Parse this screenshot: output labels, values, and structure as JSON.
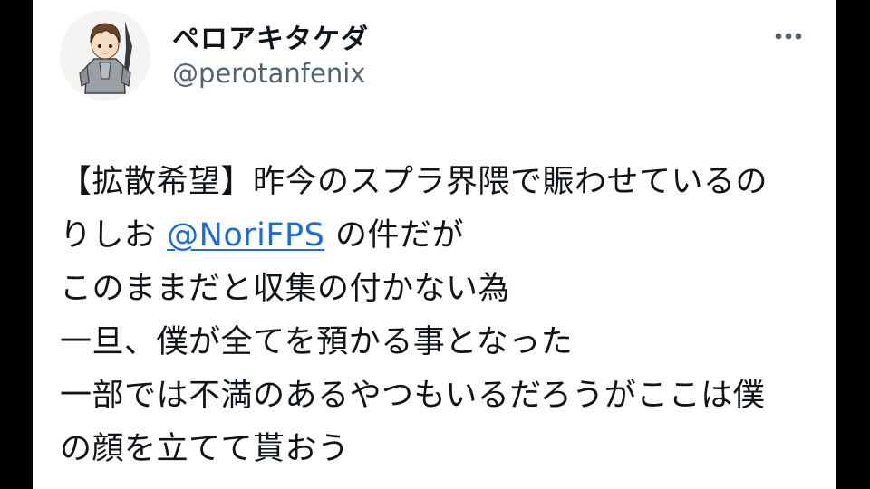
{
  "author": {
    "display_name": "ペロアキタケダ",
    "handle": "@perotanfenix",
    "avatar_icon": "avatar-armored-character"
  },
  "menu": {
    "icon": "more-horizontal-icon"
  },
  "tweet": {
    "line1": "【拡散希望】昨今のスプラ界隈で賑わせているの",
    "line2_before": "りしお ",
    "mention": "@NoriFPS",
    "line2_after": " の件だが",
    "line3": "このままだと収集の付かない為",
    "line4": "一旦、僕が全てを預かる事となった",
    "line5": "一部では不満のあるやつもいるだろうがここは僕",
    "line6": "の顔を立てて貰おう"
  },
  "colors": {
    "text": "#0f1419",
    "secondary": "#536471",
    "link": "#1d6bd6",
    "frame": "#000000",
    "card": "#ffffff"
  }
}
